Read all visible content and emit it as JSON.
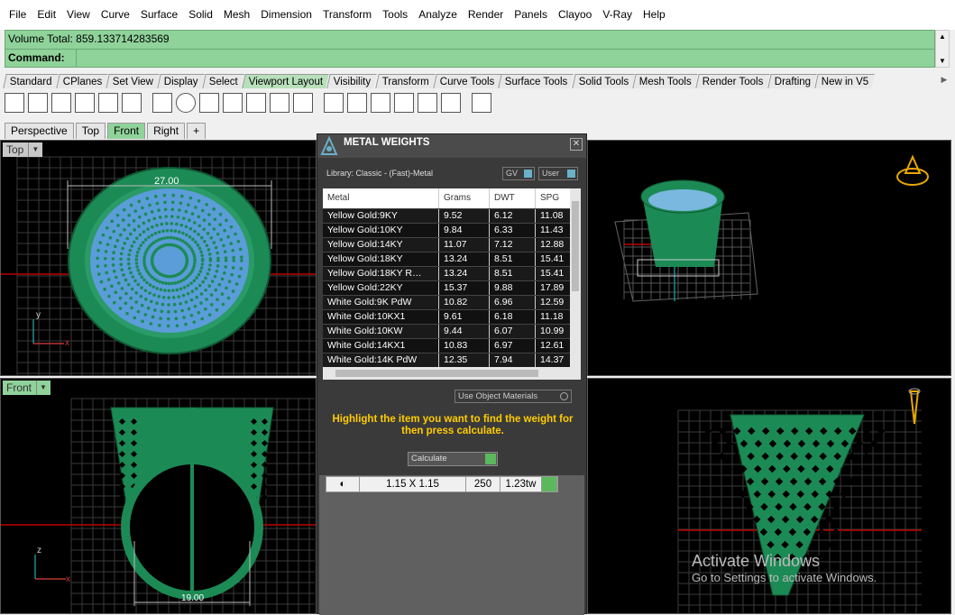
{
  "menu": [
    "File",
    "Edit",
    "View",
    "Curve",
    "Surface",
    "Solid",
    "Mesh",
    "Dimension",
    "Transform",
    "Tools",
    "Analyze",
    "Render",
    "Panels",
    "Clayoo",
    "V-Ray",
    "Help"
  ],
  "command": {
    "history": "Volume Total: 859.133714283569",
    "label": "Command:"
  },
  "toolbar_tabs": [
    "Standard",
    "CPlanes",
    "Set View",
    "Display",
    "Select",
    "Viewport Layout",
    "Visibility",
    "Transform",
    "Curve Tools",
    "Surface Tools",
    "Solid Tools",
    "Mesh Tools",
    "Render Tools",
    "Drafting",
    "New in V5"
  ],
  "active_toolbar_tab": 5,
  "viewport_tabs": [
    "Perspective",
    "Top",
    "Front",
    "Right",
    "+"
  ],
  "active_viewport_tab": 2,
  "viewports": {
    "top": {
      "label": "Top",
      "dim": "27.00",
      "axis_y": "y",
      "axis_x": "x"
    },
    "front": {
      "label": "Front",
      "dim": "19.00",
      "axis_z": "z",
      "axis_x": "x"
    }
  },
  "metal_weights": {
    "title": "METAL WEIGHTS",
    "library": "Library: Classic - (Fast)-Metal",
    "gv_label": "GV",
    "user_label": "User",
    "columns": [
      "Metal",
      "Grams",
      "DWT",
      "SPG"
    ],
    "rows": [
      [
        "Yellow Gold:9KY",
        "9.52",
        "6.12",
        "11.08"
      ],
      [
        "Yellow Gold:10KY",
        "9.84",
        "6.33",
        "11.43"
      ],
      [
        "Yellow Gold:14KY",
        "11.07",
        "7.12",
        "12.88"
      ],
      [
        "Yellow Gold:18KY",
        "13.24",
        "8.51",
        "15.41"
      ],
      [
        "Yellow Gold:18KY R…",
        "13.24",
        "8.51",
        "15.41"
      ],
      [
        "Yellow Gold:22KY",
        "15.37",
        "9.88",
        "17.89"
      ],
      [
        "White Gold:9K PdW",
        "10.82",
        "6.96",
        "12.59"
      ],
      [
        "White Gold:10KX1",
        "9.61",
        "6.18",
        "11.18"
      ],
      [
        "White Gold:10KW",
        "9.44",
        "6.07",
        "10.99"
      ],
      [
        "White Gold:14KX1",
        "10.83",
        "6.97",
        "12.61"
      ],
      [
        "White Gold:14K PdW",
        "12.35",
        "7.94",
        "14.37"
      ]
    ],
    "use_object_materials": "Use Object Materials",
    "hint": "Highlight the item you want to find the weight for then press calculate.",
    "calculate": "Calculate"
  },
  "stone_row": {
    "size": "1.15 X 1.15",
    "count": "250",
    "tw": "1.23tw"
  },
  "watermark": {
    "line1": "Activate Windows",
    "line2": "Go to Settings to activate Windows."
  }
}
